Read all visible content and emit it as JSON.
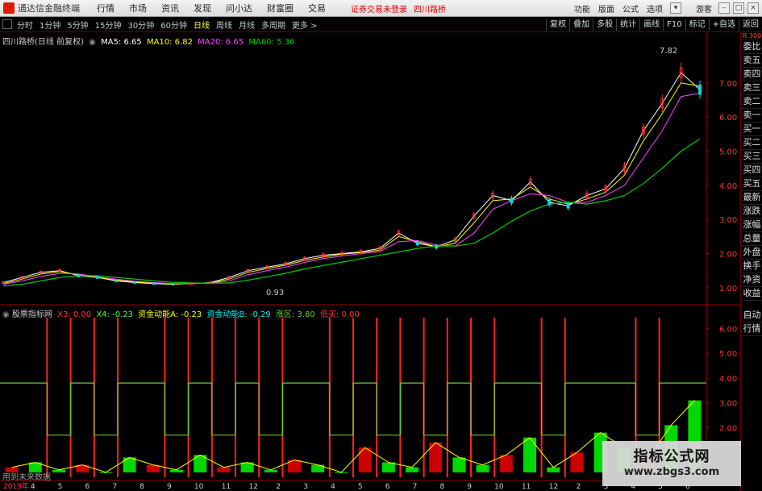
{
  "app": {
    "title": "通达信金融终端",
    "menus": [
      "行情",
      "市场",
      "资讯",
      "发现",
      "问小达",
      "财富圈",
      "交易"
    ],
    "notice": "证券交易未登录",
    "stock_name": "四川路桥",
    "right_menus": [
      "功能",
      "版面",
      "公式",
      "选项"
    ],
    "guest": "游客"
  },
  "toolbar": {
    "periods": [
      "分时",
      "1分钟",
      "5分钟",
      "15分钟",
      "30分钟",
      "60分钟",
      "日线",
      "周线",
      "月线",
      "多周期",
      "更多 >"
    ],
    "active_period": "日线",
    "right_buttons": [
      "复权",
      "叠加",
      "多股",
      "统计",
      "画线",
      "F10",
      "标记",
      "+自选",
      "返回"
    ]
  },
  "kline_header": {
    "title": "四川路桥(日线 前复权)",
    "ma5": "MA5: 6.65",
    "ma10": "MA10: 6.82",
    "ma20": "MA20: 6.65",
    "ma60": "MA60: 5.36"
  },
  "kline_annotations": {
    "high": "7.82",
    "low": "0.93"
  },
  "indicator_header": {
    "title": "股票指标网",
    "x3": "X3: 0.00",
    "x4": "X4: -0.23",
    "fa": "资金动能A: -0.23",
    "fb": "资金动能B: -0.29",
    "zone": "涨区: 3.80",
    "low": "低买: 0.00"
  },
  "indicator_note": "用到未来数据",
  "sidebar": {
    "top": "R 300",
    "tabs": [
      "委比",
      "卖五",
      "卖四",
      "卖三",
      "卖二",
      "卖一",
      "买一",
      "买二",
      "买三",
      "买四",
      "买五",
      "最新",
      "涨跌",
      "涨幅",
      "总量",
      "外盘",
      "换手",
      "净资",
      "收益"
    ],
    "lower_tabs": [
      "自动",
      "行情"
    ]
  },
  "x_axis_labels": [
    "2019年",
    "4",
    "5",
    "6",
    "7",
    "8",
    "9",
    "10",
    "11",
    "12",
    "2",
    "3",
    "4",
    "5",
    "6",
    "7",
    "8",
    "9",
    "10",
    "11",
    "12",
    "2",
    "3",
    "4",
    "5",
    "6"
  ],
  "watermark": {
    "line1": "指标公式网",
    "line2": "www.zbgs3.com"
  },
  "colors": {
    "up": "#ff3333",
    "down": "#00e0e0",
    "ma5": "#ffffff",
    "ma10": "#ffff00",
    "ma20": "#ff44ff",
    "ma60": "#00cc00",
    "signal": "#ff2222",
    "zone": "#66cc33"
  },
  "chart_data": [
    {
      "type": "line",
      "title": "四川路桥(日线 前复权)",
      "ylim": [
        0.5,
        8.2
      ],
      "y_ticks": [
        1.0,
        2.0,
        3.0,
        4.0,
        5.0,
        6.0,
        7.0
      ],
      "x_labels": [
        "2019年",
        "4",
        "5",
        "6",
        "7",
        "8",
        "9",
        "10",
        "11",
        "12",
        "2",
        "3",
        "4",
        "5",
        "6",
        "7",
        "8",
        "9",
        "10",
        "11",
        "12",
        "2",
        "3",
        "4",
        "5",
        "6"
      ],
      "series": [
        {
          "name": "MA5",
          "values": [
            1.15,
            1.3,
            1.45,
            1.5,
            1.35,
            1.3,
            1.2,
            1.15,
            1.12,
            1.1,
            1.12,
            1.15,
            1.3,
            1.5,
            1.6,
            1.7,
            1.85,
            1.95,
            2.0,
            2.05,
            2.15,
            2.6,
            2.3,
            2.2,
            2.4,
            3.1,
            3.7,
            3.55,
            4.1,
            3.5,
            3.4,
            3.7,
            3.9,
            4.5,
            5.6,
            6.4,
            7.3,
            6.8
          ]
        },
        {
          "name": "MA10",
          "values": [
            1.12,
            1.25,
            1.4,
            1.47,
            1.38,
            1.3,
            1.22,
            1.17,
            1.13,
            1.11,
            1.12,
            1.14,
            1.25,
            1.45,
            1.56,
            1.66,
            1.8,
            1.9,
            1.98,
            2.03,
            2.1,
            2.5,
            2.35,
            2.2,
            2.3,
            2.9,
            3.55,
            3.6,
            3.95,
            3.6,
            3.45,
            3.6,
            3.8,
            4.3,
            5.3,
            6.1,
            7.0,
            6.9
          ]
        },
        {
          "name": "MA20",
          "values": [
            1.1,
            1.2,
            1.33,
            1.42,
            1.4,
            1.32,
            1.25,
            1.19,
            1.15,
            1.12,
            1.12,
            1.13,
            1.2,
            1.38,
            1.5,
            1.6,
            1.74,
            1.85,
            1.93,
            2.0,
            2.06,
            2.35,
            2.38,
            2.25,
            2.22,
            2.6,
            3.3,
            3.55,
            3.75,
            3.7,
            3.5,
            3.5,
            3.7,
            4.0,
            4.8,
            5.6,
            6.6,
            6.7
          ]
        },
        {
          "name": "MA60",
          "values": [
            1.05,
            1.1,
            1.2,
            1.3,
            1.35,
            1.35,
            1.3,
            1.25,
            1.2,
            1.16,
            1.14,
            1.13,
            1.14,
            1.22,
            1.32,
            1.42,
            1.55,
            1.65,
            1.75,
            1.85,
            1.95,
            2.05,
            2.15,
            2.22,
            2.22,
            2.3,
            2.6,
            2.95,
            3.25,
            3.45,
            3.5,
            3.45,
            3.55,
            3.7,
            4.05,
            4.5,
            5.0,
            5.36
          ]
        }
      ]
    },
    {
      "type": "line",
      "title": "股票指标网",
      "ylim": [
        0,
        6.5
      ],
      "y_ticks": [
        2.0,
        3.0,
        4.0,
        5.0,
        6.0
      ],
      "series": [
        {
          "name": "涨区",
          "values": [
            3.8,
            3.8,
            1.7,
            3.8,
            1.7,
            3.8,
            3.8,
            1.7,
            3.8,
            1.7,
            3.8,
            1.7,
            3.8,
            3.8,
            1.7,
            3.8,
            1.7,
            3.8,
            1.7,
            3.8,
            1.7,
            3.8,
            3.8,
            1.7,
            3.8,
            3.8,
            3.8,
            1.7,
            3.8,
            3.8
          ]
        },
        {
          "name": "资金动能A",
          "values": [
            0.4,
            0.6,
            0.3,
            0.5,
            0.2,
            0.8,
            0.5,
            0.3,
            0.9,
            0.4,
            0.6,
            0.3,
            0.7,
            0.5,
            0.2,
            1.2,
            0.6,
            0.4,
            1.4,
            0.8,
            0.5,
            0.9,
            1.6,
            0.4,
            1.0,
            1.8,
            1.2,
            0.7,
            2.1,
            3.1
          ]
        }
      ]
    }
  ]
}
